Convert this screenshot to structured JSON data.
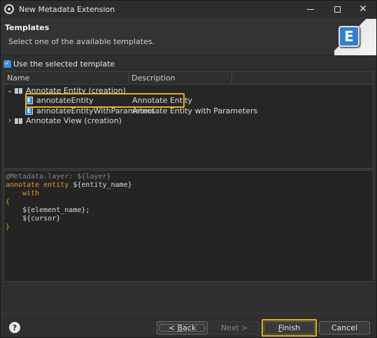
{
  "window": {
    "title": "New Metadata Extension"
  },
  "header": {
    "title": "Templates",
    "description": "Select one of the available templates."
  },
  "checkbox": {
    "label": "Use the selected template",
    "checked": true
  },
  "tree": {
    "columns": [
      "Name",
      "Description"
    ],
    "rows": [
      {
        "label": "Annotate Entity (creation)",
        "description": "",
        "expanded": true,
        "level": 0,
        "icon": "book-icon"
      },
      {
        "label": "annotateEntity",
        "description": "Annotate Entity",
        "level": 1,
        "icon": "e-template-icon",
        "selected": true
      },
      {
        "label": "annotateEntityWithParameters",
        "description": "Annotate Entity with Parameters",
        "level": 1,
        "icon": "e-template-icon"
      },
      {
        "label": "Annotate View (creation)",
        "description": "",
        "expanded": false,
        "level": 0,
        "icon": "book-icon"
      }
    ]
  },
  "code": {
    "lines": [
      {
        "parts": [
          {
            "t": "@Metadata.layer: ${layer}",
            "c": "ann"
          }
        ]
      },
      {
        "parts": [
          {
            "t": "annotate entity ",
            "c": "kw"
          },
          {
            "t": "${entity_name}",
            "c": "var"
          }
        ]
      },
      {
        "parts": [
          {
            "t": "    with",
            "c": "kw"
          }
        ]
      },
      {
        "parts": [
          {
            "t": "{",
            "c": "kw"
          }
        ]
      },
      {
        "parts": [
          {
            "t": "    ${element_name};",
            "c": "var"
          }
        ]
      },
      {
        "parts": [
          {
            "t": "    ${cursor}",
            "c": "var"
          }
        ]
      },
      {
        "parts": [
          {
            "t": "}",
            "c": "kw"
          }
        ]
      }
    ]
  },
  "footer": {
    "help": "?",
    "back_prefix": "< ",
    "back_mnemonic": "B",
    "back_rest": "ack",
    "next": "Next >",
    "finish_mnemonic": "F",
    "finish_rest": "inish",
    "cancel": "Cancel"
  },
  "colors": {
    "accent": "#3c8fd6",
    "highlight": "#e8b21a",
    "keyword": "#e8972a"
  }
}
